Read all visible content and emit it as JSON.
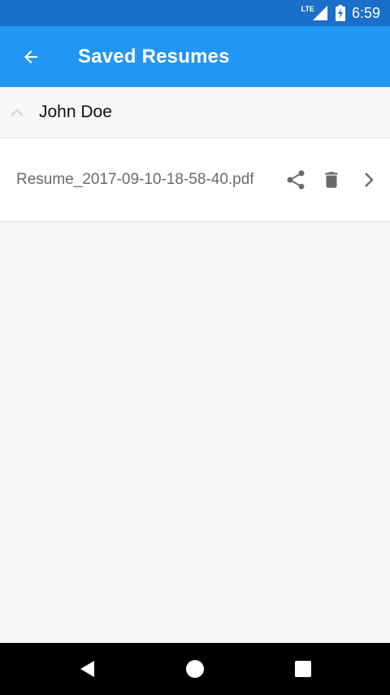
{
  "status_bar": {
    "network": "LTE",
    "time": "6:59"
  },
  "app_bar": {
    "back_icon": "arrow-back-icon",
    "title": "Saved Resumes"
  },
  "group": {
    "name": "John Doe",
    "expanded": true
  },
  "files": [
    {
      "name": "Resume_2017-09-10-18-58-40.pdf",
      "actions": [
        "share-icon",
        "delete-icon",
        "chevron-right-icon"
      ]
    }
  ],
  "nav_bar": {
    "buttons": [
      "back-triangle-icon",
      "home-circle-icon",
      "recents-square-icon"
    ]
  },
  "colors": {
    "status_bar": "#1a6fc8",
    "app_bar": "#2196f3",
    "background": "#f7f7f9",
    "row_background": "#ffffff",
    "icon_gray": "#6a6a6a"
  }
}
